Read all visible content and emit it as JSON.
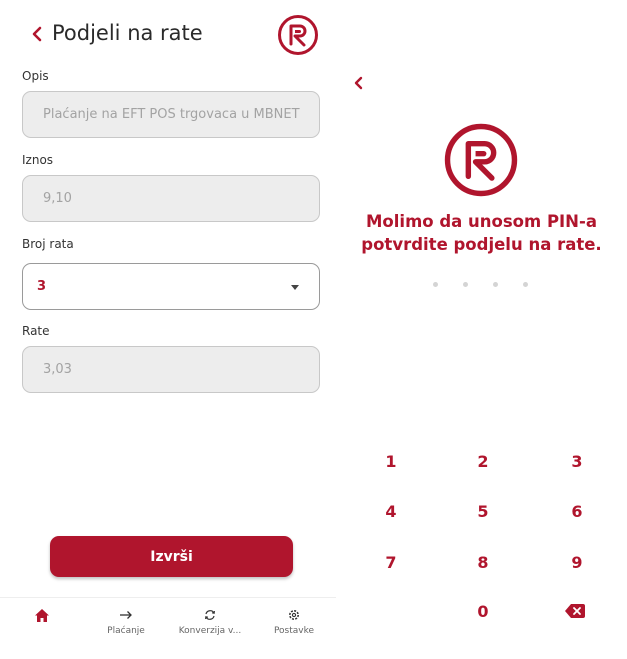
{
  "colors": {
    "accent": "#b0152d",
    "field_bg": "#ededed",
    "text_muted": "#a3a3a3"
  },
  "left_screen": {
    "header": {
      "title": "Podjeli na rate",
      "back_icon": "chevron-left-icon",
      "logo_icon": "bank-logo-icon"
    },
    "fields": [
      {
        "label": "Opis",
        "value": "Plaćanje na EFT POS trgovaca u MBNET"
      },
      {
        "label": "Iznos",
        "value": "9,10"
      },
      {
        "label": "Broj rata",
        "value": "3"
      },
      {
        "label": "Rate",
        "value": "3,03"
      }
    ],
    "execute_label": "Izvrši",
    "tabbar": [
      {
        "label": "",
        "icon": "home-icon"
      },
      {
        "label": "Plaćanje",
        "icon": "arrow-right-icon"
      },
      {
        "label": "Konverzija v...",
        "icon": "refresh-icon"
      },
      {
        "label": "Postavke",
        "icon": "gear-icon"
      }
    ]
  },
  "right_screen": {
    "back_icon": "chevron-left-icon",
    "logo_icon": "bank-logo-icon",
    "prompt_line1": "Molimo da unosom PIN-a",
    "prompt_line2": "potvrdite podjelu na rate.",
    "pin_length": 4,
    "pin_entered": 0,
    "keypad": [
      "1",
      "2",
      "3",
      "4",
      "5",
      "6",
      "7",
      "8",
      "9",
      "0"
    ],
    "delete_icon": "backspace-icon"
  }
}
